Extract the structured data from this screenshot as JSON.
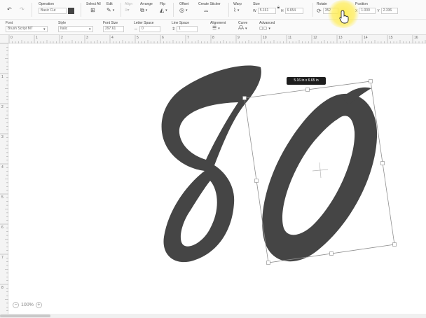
{
  "toolbar": {
    "undo_icon": "undo-icon",
    "redo_icon": "redo-icon",
    "operation": {
      "label": "Operation",
      "value": "Basic Cut",
      "color": "#444444"
    },
    "select_all": {
      "label": "Select All"
    },
    "edit": {
      "label": "Edit"
    },
    "align": {
      "label": "Align"
    },
    "arrange": {
      "label": "Arrange"
    },
    "flip": {
      "label": "Flip"
    },
    "offset": {
      "label": "Offset"
    },
    "create_sticker": {
      "label": "Create Sticker"
    },
    "warp": {
      "label": "Warp"
    },
    "size": {
      "label": "Size",
      "w_prefix": "W",
      "w": "5.161",
      "h_prefix": "H",
      "h": "6.654"
    },
    "rotate": {
      "label": "Rotate",
      "value": "352"
    },
    "position": {
      "label": "Position",
      "x_prefix": "X",
      "x": "1.000",
      "y_prefix": "Y",
      "y": "2.336"
    }
  },
  "text_toolbar": {
    "font": {
      "label": "Font",
      "value": "Brush Script MT"
    },
    "style": {
      "label": "Style",
      "value": "Italic"
    },
    "font_size": {
      "label": "Font Size",
      "value": "297.61"
    },
    "letter_space": {
      "label": "Letter Space",
      "value": "0"
    },
    "line_space": {
      "label": "Line Space",
      "value": "1"
    },
    "alignment": {
      "label": "Alignment"
    },
    "curve": {
      "label": "Curve"
    },
    "advanced": {
      "label": "Advanced"
    }
  },
  "ruler": {
    "h_numbers": [
      "0",
      "1",
      "2",
      "3",
      "4",
      "5",
      "6",
      "7",
      "8",
      "9",
      "10",
      "11",
      "12",
      "13",
      "14",
      "15",
      "16"
    ],
    "v_numbers": [
      "1",
      "2",
      "3",
      "4",
      "5",
      "6",
      "7",
      "8"
    ]
  },
  "canvas": {
    "text_content": "80",
    "fill_color": "#454545",
    "dimension_label": "5.16  in x 6.65  in"
  },
  "zoom": {
    "value": "100%",
    "minus": "−",
    "plus": "+"
  }
}
